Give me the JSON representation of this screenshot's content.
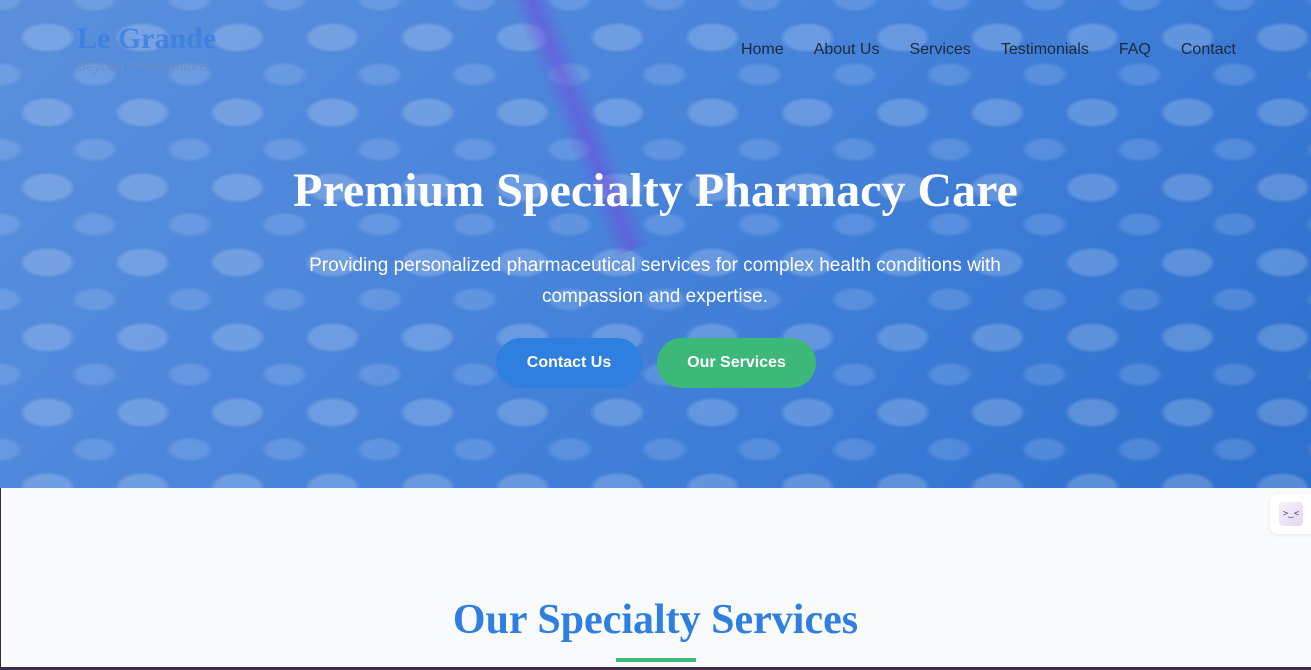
{
  "brand": {
    "name": "Le Grande",
    "tagline": "Beyond Prescriptions"
  },
  "nav": {
    "items": [
      {
        "label": "Home"
      },
      {
        "label": "About Us"
      },
      {
        "label": "Services"
      },
      {
        "label": "Testimonials"
      },
      {
        "label": "FAQ"
      },
      {
        "label": "Contact"
      }
    ]
  },
  "hero": {
    "title": "Premium Specialty Pharmacy Care",
    "subtitle": "Providing personalized pharmaceutical services for complex health conditions with compassion and expertise.",
    "contact_label": "Contact Us",
    "services_label": "Our Services"
  },
  "widget": {
    "icon": "face-icon",
    "glyph": ">‿<"
  },
  "services": {
    "title": "Our Specialty Services"
  },
  "colors": {
    "primary": "#2f7fe0",
    "accent": "#3cb878"
  }
}
